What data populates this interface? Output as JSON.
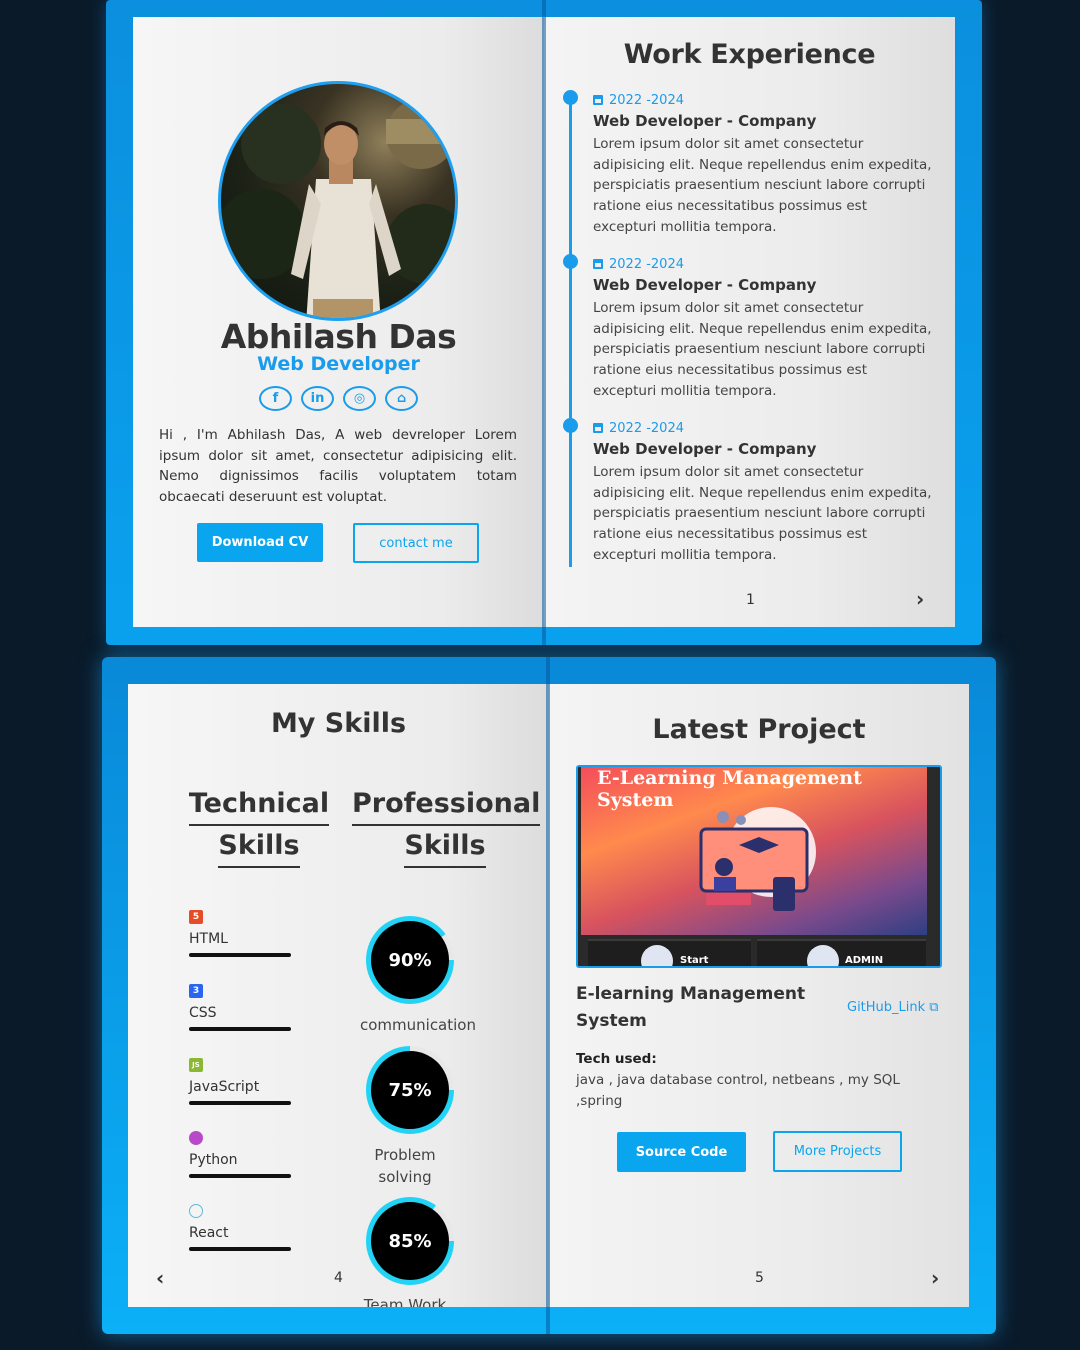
{
  "profile": {
    "name": "Abhilash Das",
    "role": "Web Developer",
    "bio": "Hi , I'm Abhilash Das, A web devreloper Lorem ipsum dolor sit amet, consectetur adipisicing elit. Nemo dignissimos facilis voluptatem totam obcaecati deseruunt est voluptat.",
    "socials": [
      {
        "icon": "facebook-icon",
        "glyph": "f"
      },
      {
        "icon": "linkedin-icon",
        "glyph": "in"
      },
      {
        "icon": "instagram-icon",
        "glyph": "◎"
      },
      {
        "icon": "github-icon",
        "glyph": "⌂"
      }
    ],
    "download_label": "Download CV",
    "contact_label": "contact me"
  },
  "work": {
    "heading": "Work Experience",
    "items": [
      {
        "date": "2022 -2024",
        "title": "Web Developer - Company",
        "desc": "Lorem ipsum dolor sit amet consectetur adipisicing elit. Neque repellendus enim expedita, perspiciatis praesentium nesciunt labore corrupti ratione eius necessitatibus possimus est excepturi mollitia tempora."
      },
      {
        "date": "2022 -2024",
        "title": "Web Developer - Company",
        "desc": "Lorem ipsum dolor sit amet consectetur adipisicing elit. Neque repellendus enim expedita, perspiciatis praesentium nesciunt labore corrupti ratione eius necessitatibus possimus est excepturi mollitia tempora."
      },
      {
        "date": "2022 -2024",
        "title": "Web Developer - Company",
        "desc": "Lorem ipsum dolor sit amet consectetur adipisicing elit. Neque repellendus enim expedita, perspiciatis praesentium nesciunt labore corrupti ratione eius necessitatibus possimus est excepturi mollitia tempora."
      }
    ],
    "page_number": "1",
    "next_arrow": "›"
  },
  "skills": {
    "heading": "My Skills",
    "technical_heading_1": "Technical",
    "technical_heading_2": "Skills",
    "professional_heading_1": "Professional",
    "professional_heading_2": "Skills",
    "technical": [
      {
        "name": "HTML",
        "icon": "html5-icon",
        "badge": "5",
        "color": "#e44d26"
      },
      {
        "name": "CSS",
        "icon": "css3-icon",
        "badge": "3",
        "color": "#2965f1"
      },
      {
        "name": "JavaScript",
        "icon": "javascript-icon",
        "badge": "JS",
        "color": "#8bb832"
      },
      {
        "name": "Python",
        "icon": "python-icon",
        "badge": "",
        "color": "#b84ac9"
      },
      {
        "name": "React",
        "icon": "react-icon",
        "badge": "",
        "color": "#61b9d6"
      }
    ],
    "professional": [
      {
        "percent": "90%",
        "value": 90,
        "label": "communication"
      },
      {
        "percent": "75%",
        "value": 75,
        "label": "Problem solving"
      },
      {
        "percent": "85%",
        "value": 85,
        "label": "Team Work"
      }
    ],
    "page_number": "4",
    "prev_arrow": "‹"
  },
  "project": {
    "heading": "Latest Project",
    "image_title": "E-Learning Management System",
    "start_label": "Start",
    "admin_label": "ADMIN",
    "name": "E-learning Management System",
    "github_label": "GitHub_Link",
    "tech_label": "Tech used:",
    "tech_list": "java , java database control, netbeans , my SQL ,spring",
    "source_label": "Source Code",
    "more_label": "More Projects",
    "page_number": "5",
    "next_arrow": "›"
  },
  "colors": {
    "accent": "#09a6ef",
    "background": "#0a1a29"
  }
}
